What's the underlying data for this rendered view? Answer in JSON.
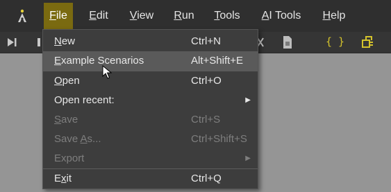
{
  "menubar": {
    "items": [
      {
        "pre": "",
        "u": "F",
        "post": "ile"
      },
      {
        "pre": "",
        "u": "E",
        "post": "dit"
      },
      {
        "pre": "",
        "u": "V",
        "post": "iew"
      },
      {
        "pre": "",
        "u": "R",
        "post": "un"
      },
      {
        "pre": "",
        "u": "T",
        "post": "ools"
      },
      {
        "pre": "",
        "u": "A",
        "post": "I Tools"
      },
      {
        "pre": "",
        "u": "H",
        "post": "elp"
      }
    ]
  },
  "toolbar": {
    "icons": [
      "run-to-end-icon",
      "step-icon",
      "close-icon",
      "file-icon",
      "braces-icon",
      "plugin-icon"
    ],
    "braces_text": "{ }"
  },
  "file_menu": {
    "items": [
      {
        "pre": "",
        "u": "N",
        "post": "ew",
        "shortcut": "Ctrl+N"
      },
      {
        "pre": "",
        "u": "E",
        "post": "xample Scenarios",
        "shortcut": "Alt+Shift+E"
      },
      {
        "pre": "",
        "u": "O",
        "post": "pen",
        "shortcut": "Ctrl+O"
      },
      {
        "label": "Open recent:",
        "arrow": "▶"
      },
      {
        "pre": "",
        "u": "S",
        "post": "ave",
        "shortcut": "Ctrl+S"
      },
      {
        "pre": "Save ",
        "u": "A",
        "post": "s...",
        "shortcut": "Ctrl+Shift+S"
      },
      {
        "label": "Export",
        "arrow": "▶"
      },
      {
        "pre": "E",
        "u": "x",
        "post": "it",
        "shortcut": "Ctrl+Q"
      }
    ]
  },
  "colors": {
    "menubar_bg": "#2f2f2f",
    "active_menu_bg": "#7a6a10",
    "dropdown_bg": "#3d3d3d",
    "hover_bg": "#5a5a5a",
    "disabled_text": "#7e7e7e",
    "canvas_bg": "#959595",
    "accent_yellow": "#d4c32c"
  }
}
